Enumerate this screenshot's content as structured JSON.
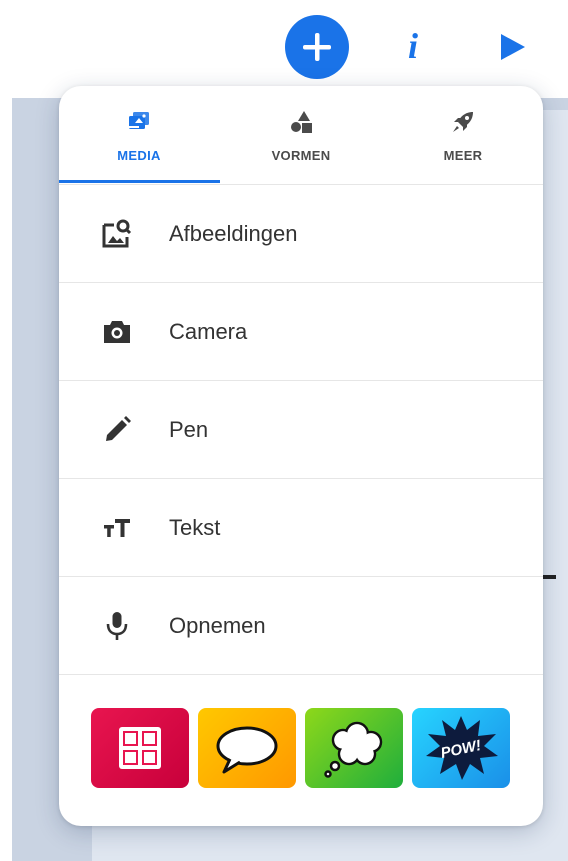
{
  "toolbar": {
    "add_icon": "plus-icon",
    "info_label": "i",
    "play_icon": "play-icon",
    "accent": "#1a73e8"
  },
  "tabs": [
    {
      "label": "MEDIA",
      "icon": "media-icon",
      "active": true
    },
    {
      "label": "VORMEN",
      "icon": "shapes-icon",
      "active": false
    },
    {
      "label": "MEER",
      "icon": "rocket-icon",
      "active": false
    }
  ],
  "menu": [
    {
      "label": "Afbeeldingen",
      "icon": "image-search-icon"
    },
    {
      "label": "Camera",
      "icon": "camera-icon"
    },
    {
      "label": "Pen",
      "icon": "pen-icon"
    },
    {
      "label": "Tekst",
      "icon": "text-size-icon"
    },
    {
      "label": "Opnemen",
      "icon": "microphone-icon"
    }
  ],
  "stickers": [
    {
      "name": "grid-layout-sticker",
      "color": "#e8154f"
    },
    {
      "name": "speech-bubble-sticker",
      "color": "#ffb300"
    },
    {
      "name": "thought-bubble-sticker",
      "color": "#3fbf2a"
    },
    {
      "name": "pow-sticker",
      "color": "#1fb0f0",
      "text": "POW!"
    }
  ]
}
